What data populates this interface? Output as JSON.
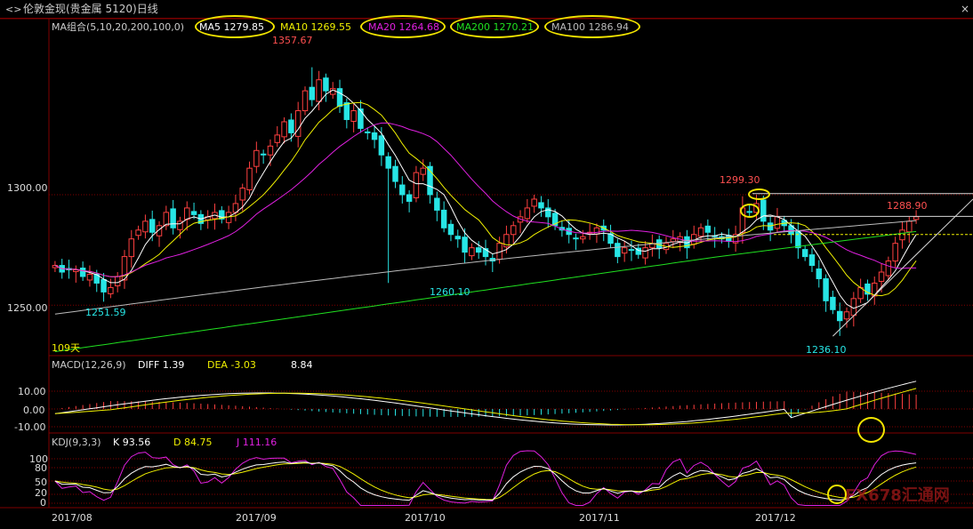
{
  "window": {
    "title": "伦敦金现(贵金属 5120)日线",
    "close_label": "×"
  },
  "ma_header": {
    "group_label": "MA组合(5,10,20,200,100,0)",
    "ma5": "MA5 1279.85",
    "ma10": "MA10 1269.55",
    "ma20": "MA20 1264.68",
    "ma200": "MA200 1270.21",
    "ma100": "MA100 1286.94"
  },
  "price_axis": {
    "ticks": [
      "1300.00",
      "1250.00"
    ],
    "days_label": "109天"
  },
  "annotations": {
    "high1": "1357.67",
    "low1": "1251.59",
    "low2": "1260.10",
    "high2": "1299.30",
    "low3": "1236.10",
    "last": "1288.90"
  },
  "macd_header": {
    "label": "MACD(12,26,9)",
    "diff": "DIFF  1.39",
    "dea": "DEA  -3.03",
    "macd": "8.84",
    "ticks": [
      "10.00",
      "0.00",
      "-10.00"
    ]
  },
  "kdj_header": {
    "label": "KDJ(9,3,3)",
    "k": "K  93.56",
    "d": "D  84.75",
    "j": "J  111.16",
    "ticks": [
      "100",
      "80",
      "50",
      "20",
      "0"
    ]
  },
  "x_axis": {
    "labels": [
      "2017/08",
      "2017/09",
      "2017/10",
      "2017/11",
      "2017/12"
    ]
  },
  "watermark": "FX678汇通网",
  "colors": {
    "up": "#ff4040",
    "down": "#27e5e5",
    "ma5": "#ffffff",
    "ma10": "#f0f000",
    "ma20": "#e020e0",
    "ma200": "#20e020",
    "ma100": "#bbbbbb",
    "grid": "#800000",
    "highlight": "#f2e400"
  },
  "chart_data": [
    {
      "type": "candlestick",
      "title": "伦敦金现(贵金属 5120)日线",
      "period_label": "109天",
      "ylim": [
        1228,
        1372
      ],
      "y_ticks": [
        1300,
        1250
      ],
      "x_labels": [
        "2017/08",
        "2017/09",
        "2017/10",
        "2017/11",
        "2017/12"
      ],
      "series": [
        {
          "name": "MA5",
          "last": 1279.85
        },
        {
          "name": "MA10",
          "last": 1269.55
        },
        {
          "name": "MA20",
          "last": 1264.68
        },
        {
          "name": "MA200",
          "last": 1270.21
        },
        {
          "name": "MA100",
          "last": 1286.94
        }
      ],
      "close_values": [
        1268,
        1265,
        1266,
        1266,
        1263,
        1264,
        1260,
        1256,
        1258,
        1263,
        1272,
        1280,
        1284,
        1288,
        1283,
        1286,
        1292,
        1285,
        1288,
        1294,
        1291,
        1287,
        1290,
        1292,
        1289,
        1292,
        1296,
        1303,
        1312,
        1320,
        1318,
        1322,
        1327,
        1333,
        1328,
        1338,
        1347,
        1343,
        1352,
        1347,
        1348,
        1340,
        1334,
        1338,
        1330,
        1328,
        1325,
        1318,
        1312,
        1306,
        1300,
        1297,
        1310,
        1312,
        1300,
        1293,
        1285,
        1282,
        1280,
        1274,
        1276,
        1274,
        1272,
        1270,
        1278,
        1282,
        1286,
        1290,
        1294,
        1298,
        1294,
        1290,
        1286,
        1284,
        1282,
        1280,
        1281,
        1283,
        1285,
        1284,
        1278,
        1272,
        1276,
        1275,
        1273,
        1276,
        1278,
        1276,
        1278,
        1280,
        1281,
        1276,
        1282,
        1285,
        1283,
        1281,
        1280,
        1279,
        1282,
        1294,
        1292,
        1296,
        1288,
        1284,
        1290,
        1286,
        1282,
        1276,
        1272,
        1268,
        1262,
        1252,
        1248,
        1243,
        1247,
        1253,
        1258,
        1255,
        1260,
        1265,
        1270,
        1278,
        1284,
        1288,
        1290
      ],
      "annotations": [
        {
          "label": "1357.67",
          "value": 1357.67
        },
        {
          "label": "1251.59",
          "value": 1251.59
        },
        {
          "label": "1260.10",
          "value": 1260.1
        },
        {
          "label": "1299.30",
          "value": 1299.3
        },
        {
          "label": "1236.10",
          "value": 1236.1
        },
        {
          "label": "1288.90",
          "value": 1288.9
        }
      ]
    },
    {
      "type": "bar",
      "title": "MACD(12,26,9)",
      "series": [
        {
          "name": "DIFF",
          "last": 1.39
        },
        {
          "name": "DEA",
          "last": -3.03
        },
        {
          "name": "MACD",
          "last": 8.84
        }
      ],
      "y_ticks": [
        10,
        0,
        -10
      ],
      "ylim": [
        -14,
        20
      ]
    },
    {
      "type": "line",
      "title": "KDJ(9,3,3)",
      "series": [
        {
          "name": "K",
          "last": 93.56
        },
        {
          "name": "D",
          "last": 84.75
        },
        {
          "name": "J",
          "last": 111.16
        }
      ],
      "y_ticks": [
        100,
        80,
        50,
        20,
        0
      ],
      "ylim": [
        -5,
        120
      ]
    }
  ]
}
